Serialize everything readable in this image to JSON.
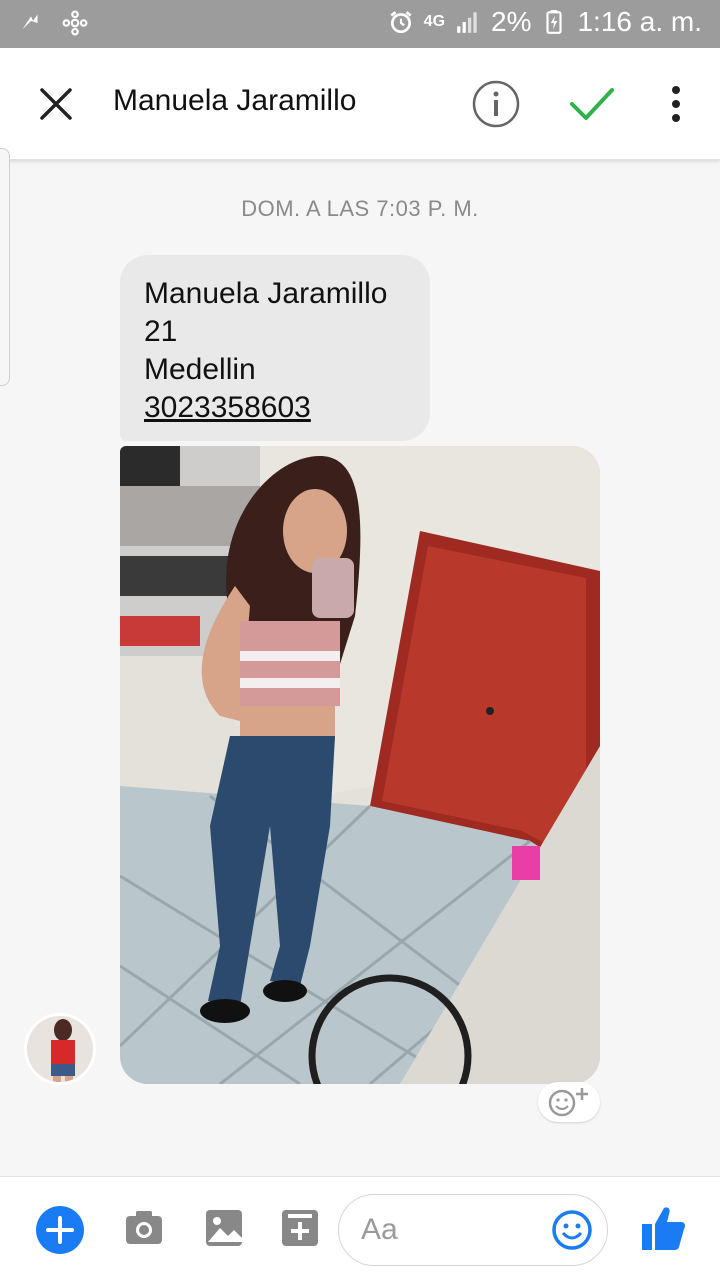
{
  "status_bar": {
    "network": "4G",
    "battery": "2%",
    "time": "1:16 a. m."
  },
  "header": {
    "title": "Manuela Jaramillo"
  },
  "conversation": {
    "timestamp": "DOM. A LAS 7:03 P. M.",
    "message_lines": [
      "Manuela Jaramillo",
      "21",
      "Medellin"
    ],
    "phone": "3023358603"
  },
  "composer": {
    "placeholder": "Aa"
  },
  "colors": {
    "accent": "#1a7cf3",
    "check": "#2fb24a",
    "status_bar": "#9c9c9c"
  }
}
